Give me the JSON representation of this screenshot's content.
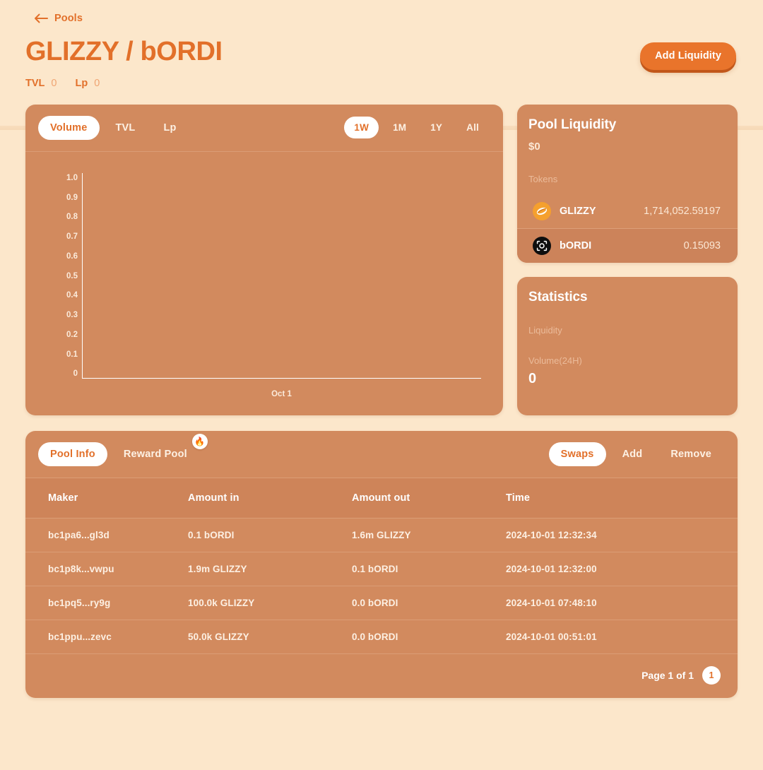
{
  "header": {
    "back_label": "Pools",
    "back_icon": "arrow-left-icon",
    "pair_title": "GLIZZY / bORDI",
    "stats": [
      {
        "key": "TVL",
        "value": "0"
      },
      {
        "key": "Lp",
        "value": "0"
      }
    ],
    "add_liquidity_label": "Add Liquidity",
    "accent_color": "#E2702A",
    "button_color": "#E9742B",
    "page_background": "#FCE7CB",
    "card_background": "#D28A5E"
  },
  "chart_card": {
    "metric_tabs": [
      {
        "label": "Volume",
        "active": true
      },
      {
        "label": "TVL",
        "active": false
      },
      {
        "label": "Lp",
        "active": false
      }
    ],
    "range_tabs": [
      {
        "label": "1W",
        "active": true
      },
      {
        "label": "1M",
        "active": false
      },
      {
        "label": "1Y",
        "active": false
      },
      {
        "label": "All",
        "active": false
      }
    ]
  },
  "chart_data": {
    "type": "line",
    "title": "Volume",
    "xlabel": "",
    "ylabel": "",
    "x": [
      "Oct 1"
    ],
    "categories": [
      "Oct 1"
    ],
    "series": [
      {
        "name": "Volume",
        "values": [
          0
        ]
      }
    ],
    "values": [
      0
    ],
    "yticks": [
      "1.0",
      "0.9",
      "0.8",
      "0.7",
      "0.6",
      "0.5",
      "0.4",
      "0.3",
      "0.2",
      "0.1",
      "0"
    ],
    "xticks": [
      "Oct 1"
    ],
    "ylim": [
      0,
      1
    ],
    "grid": false,
    "legend": false,
    "axis_color": "#FFFFFF",
    "tick_color": "#FBEADA",
    "plot_background": "#D28A5E"
  },
  "pool_liquidity": {
    "title": "Pool Liquidity",
    "amount": "$0",
    "tokens_label": "Tokens",
    "tokens": [
      {
        "icon": "glizzy-token-icon",
        "name": "GLIZZY",
        "amount": "1,714,052.59197"
      },
      {
        "icon": "bordi-token-icon",
        "name": "bORDI",
        "amount": "0.15093"
      }
    ]
  },
  "statistics": {
    "title": "Statistics",
    "items": [
      {
        "label": "Liquidity",
        "value": ""
      },
      {
        "label": "Volume(24H)",
        "value": "0"
      }
    ]
  },
  "pool_info": {
    "left_tabs": [
      {
        "label": "Pool Info",
        "active": true,
        "badge": ""
      },
      {
        "label": "Reward Pool",
        "active": false,
        "badge": "🔥"
      }
    ],
    "right_tabs": [
      {
        "label": "Swaps",
        "active": true
      },
      {
        "label": "Add",
        "active": false
      },
      {
        "label": "Remove",
        "active": false
      }
    ],
    "columns": [
      "Maker",
      "Amount in",
      "Amount out",
      "Time"
    ],
    "rows": [
      {
        "maker": "bc1pa6...gl3d",
        "amount_in": "0.1 bORDI",
        "amount_out": "1.6m GLIZZY",
        "time": "2024-10-01 12:32:34"
      },
      {
        "maker": "bc1p8k...vwpu",
        "amount_in": "1.9m GLIZZY",
        "amount_out": "0.1 bORDI",
        "time": "2024-10-01 12:32:00"
      },
      {
        "maker": "bc1pq5...ry9g",
        "amount_in": "100.0k GLIZZY",
        "amount_out": "0.0 bORDI",
        "time": "2024-10-01 07:48:10"
      },
      {
        "maker": "bc1ppu...zevc",
        "amount_in": "50.0k GLIZZY",
        "amount_out": "0.0 bORDI",
        "time": "2024-10-01 00:51:01"
      }
    ],
    "pager_text": "Page 1 of 1",
    "pager_current": "1"
  }
}
